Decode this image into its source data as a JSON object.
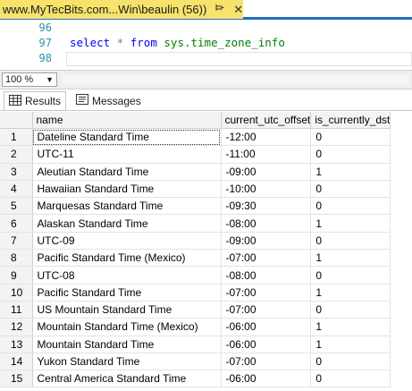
{
  "tab": {
    "title": "www.MyTecBits.com...Win\\beaulin (56))",
    "pin_icon": "pin-icon",
    "close_glyph": "✕"
  },
  "editor": {
    "lines": [
      {
        "number": "96",
        "code": ""
      },
      {
        "number": "97",
        "code": "select * from sys.time_zone_info"
      },
      {
        "number": "98",
        "code": ""
      }
    ],
    "keyword_select": "select",
    "star": "*",
    "keyword_from": "from",
    "object_name": "sys.time_zone_info"
  },
  "zoom": {
    "value": "100 %"
  },
  "result_tabs": [
    {
      "label": "Results",
      "icon": "grid-icon"
    },
    {
      "label": "Messages",
      "icon": "messages-icon"
    }
  ],
  "grid": {
    "columns": [
      "name",
      "current_utc_offset",
      "is_currently_dst"
    ],
    "rows": [
      {
        "n": "1",
        "name": "Dateline Standard Time",
        "offset": "-12:00",
        "dst": "0"
      },
      {
        "n": "2",
        "name": "UTC-11",
        "offset": "-11:00",
        "dst": "0"
      },
      {
        "n": "3",
        "name": "Aleutian Standard Time",
        "offset": "-09:00",
        "dst": "1"
      },
      {
        "n": "4",
        "name": "Hawaiian Standard Time",
        "offset": "-10:00",
        "dst": "0"
      },
      {
        "n": "5",
        "name": "Marquesas Standard Time",
        "offset": "-09:30",
        "dst": "0"
      },
      {
        "n": "6",
        "name": "Alaskan Standard Time",
        "offset": "-08:00",
        "dst": "1"
      },
      {
        "n": "7",
        "name": "UTC-09",
        "offset": "-09:00",
        "dst": "0"
      },
      {
        "n": "8",
        "name": "Pacific Standard Time (Mexico)",
        "offset": "-07:00",
        "dst": "1"
      },
      {
        "n": "9",
        "name": "UTC-08",
        "offset": "-08:00",
        "dst": "0"
      },
      {
        "n": "10",
        "name": "Pacific Standard Time",
        "offset": "-07:00",
        "dst": "1"
      },
      {
        "n": "11",
        "name": "US Mountain Standard Time",
        "offset": "-07:00",
        "dst": "0"
      },
      {
        "n": "12",
        "name": "Mountain Standard Time (Mexico)",
        "offset": "-06:00",
        "dst": "1"
      },
      {
        "n": "13",
        "name": "Mountain Standard Time",
        "offset": "-06:00",
        "dst": "1"
      },
      {
        "n": "14",
        "name": "Yukon Standard Time",
        "offset": "-07:00",
        "dst": "0"
      },
      {
        "n": "15",
        "name": "Central America Standard Time",
        "offset": "-06:00",
        "dst": "0"
      }
    ]
  },
  "colors": {
    "tab_active_bg": "#f7e26b",
    "tab_underline": "#1e6fc2",
    "keyword": "#0000ff",
    "object": "#008000",
    "line_number": "#2b91af"
  }
}
